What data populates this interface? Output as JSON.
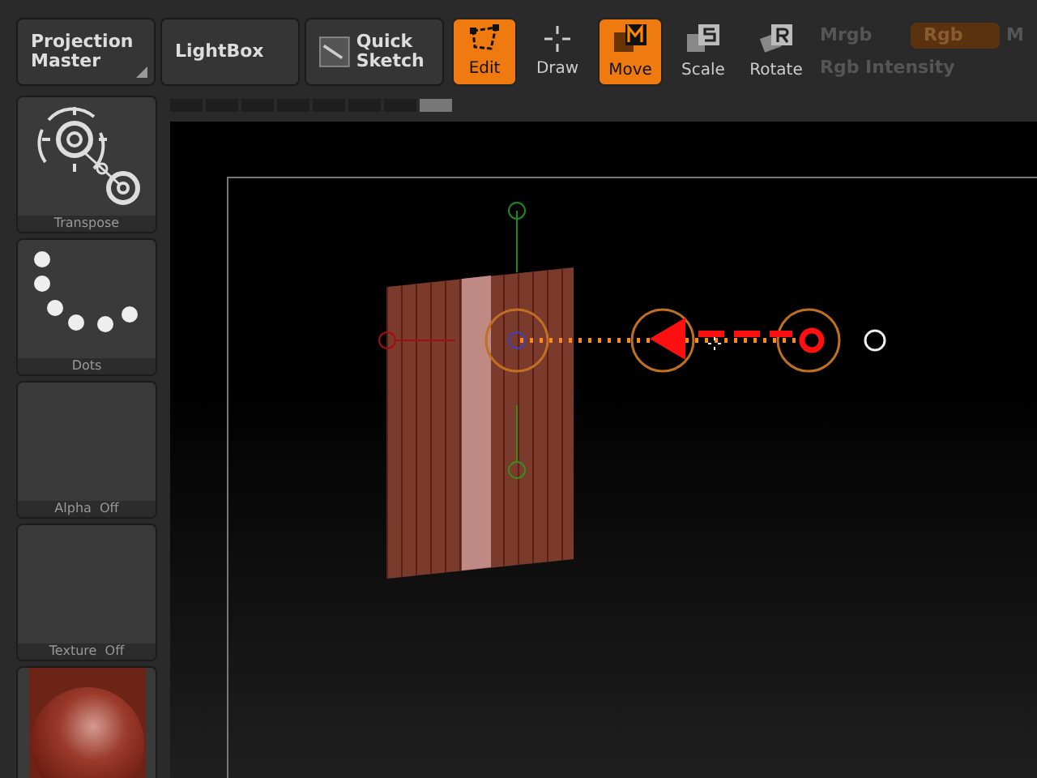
{
  "toolbar": {
    "buttons": [
      {
        "label": "Projection Master",
        "kind": "menu"
      },
      {
        "label": "LightBox",
        "kind": "plain"
      },
      {
        "label": "Quick Sketch",
        "kind": "sketch"
      }
    ],
    "modes": [
      {
        "label": "Edit",
        "kind": "edit",
        "selected": true
      },
      {
        "label": "Draw",
        "kind": "draw",
        "selected": false
      },
      {
        "label": "Move",
        "kind": "move",
        "selected": true
      },
      {
        "label": "Scale",
        "kind": "scale",
        "selected": false
      },
      {
        "label": "Rotate",
        "kind": "rotate",
        "selected": false
      }
    ],
    "color_mode": {
      "mrgb": "Mrgb",
      "rgb": "Rgb",
      "rgb_selected": true,
      "m": "M",
      "intensity_label": "Rgb Intensity"
    }
  },
  "palette": [
    {
      "label": "Transpose",
      "kind": "transpose"
    },
    {
      "label": "Dots",
      "kind": "dots"
    },
    {
      "label": "Alpha  Off",
      "kind": "empty"
    },
    {
      "label": "Texture  Off",
      "kind": "empty"
    },
    {
      "kind": "material"
    }
  ],
  "document_tabs": [
    {
      "selected": false
    },
    {
      "selected": false
    },
    {
      "selected": false
    },
    {
      "selected": false
    },
    {
      "selected": false
    },
    {
      "selected": false
    },
    {
      "selected": false
    },
    {
      "selected": true
    }
  ]
}
